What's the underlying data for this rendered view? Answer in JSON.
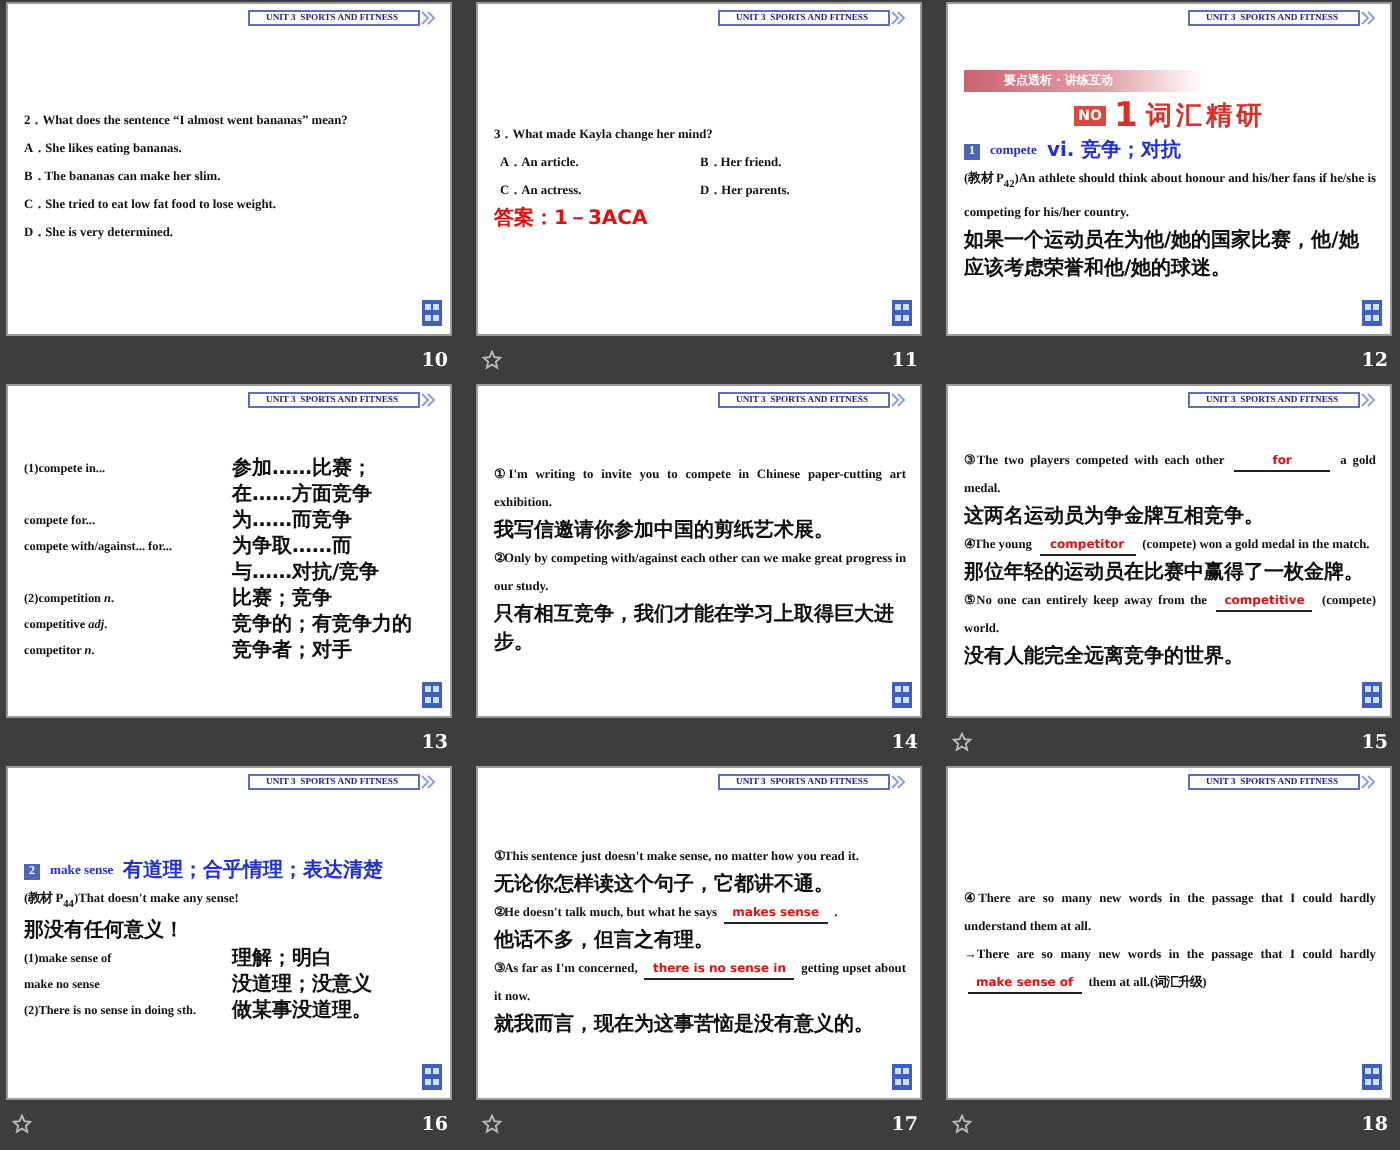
{
  "slides": [
    {
      "number": "10",
      "starred": false,
      "header": "UNIT 3  SPORTS AND FITNESS",
      "blocks": [
        {
          "kind": "en",
          "text": "2．What does the sentence “I almost went bananas” mean?"
        },
        {
          "kind": "en",
          "text": "A．She likes eating bananas."
        },
        {
          "kind": "en",
          "text": "B．The bananas can make her slim."
        },
        {
          "kind": "en",
          "text": "C．She tried to eat low fat food to lose weight."
        },
        {
          "kind": "en",
          "text": "D．She is very determined."
        }
      ]
    },
    {
      "number": "11",
      "starred": true,
      "header": "UNIT 3  SPORTS AND FITNESS",
      "blocks": [
        {
          "kind": "en",
          "text": "3．What made Kayla change her mind?"
        },
        {
          "kind": "options",
          "items": [
            "A．An article.",
            "B．Her friend.",
            "C．An actress.",
            "D．Her parents."
          ]
        },
        {
          "kind": "answer",
          "text": "答案：1－3ACA"
        }
      ]
    },
    {
      "number": "12",
      "starred": false,
      "header": "UNIT 3  SPORTS AND FITNESS",
      "blocks": [
        {
          "kind": "banner",
          "text": "要点透析 · 讲练互动",
          "badge": "NO",
          "num": "1",
          "title": "词汇精研"
        },
        {
          "kind": "heading",
          "badge": "1",
          "term": "compete",
          "meaning": "vi. 竞争；对抗"
        },
        {
          "kind": "en",
          "text": "(教材 P$_{42}$)An athlete should think about honour and his/her fans if he/she is competing for his/her country."
        },
        {
          "kind": "zh",
          "text": "如果一个运动员在为他/她的国家比赛，他/她应该考虑荣誉和他/她的球迷。"
        }
      ]
    },
    {
      "number": "13",
      "starred": false,
      "header": "UNIT 3  SPORTS AND FITNESS",
      "blocks": [
        {
          "kind": "pairs",
          "rows": [
            {
              "term": "(1)compete in...",
              "meaning": "参加……比赛；"
            },
            {
              "meaning": "在……方面竞争"
            },
            {
              "term": "compete for...",
              "meaning": "为……而竞争"
            },
            {
              "term": "compete with/against... for...",
              "meaning": "为争取……而"
            },
            {
              "meaning": "与……对抗/竞争"
            },
            {
              "term": "(2)competition *n*.",
              "meaning": "比赛；竞争"
            },
            {
              "term": "competitive *adj*.",
              "meaning": "竞争的；有竞争力的"
            },
            {
              "term": "competitor *n*.",
              "meaning": "竞争者；对手"
            }
          ]
        }
      ]
    },
    {
      "number": "14",
      "starred": false,
      "header": "UNIT 3  SPORTS AND FITNESS",
      "blocks": [
        {
          "kind": "en",
          "text": "①I'm writing to invite you to compete in Chinese paper-cutting art exhibition."
        },
        {
          "kind": "zh",
          "text": "我写信邀请你参加中国的剪纸艺术展。"
        },
        {
          "kind": "en",
          "text": "②Only by competing with/against each other can we make great progress in our study."
        },
        {
          "kind": "zh",
          "text": "只有相互竞争，我们才能在学习上取得巨大进步。"
        }
      ]
    },
    {
      "number": "15",
      "starred": true,
      "header": "UNIT 3  SPORTS AND FITNESS",
      "blocks": [
        {
          "kind": "cloze",
          "parts": [
            {
              "kind": "text",
              "text": "③The two players competed with each other"
            },
            {
              "kind": "blank",
              "text": "for"
            },
            {
              "kind": "text",
              "text": "a gold medal."
            }
          ]
        },
        {
          "kind": "zh",
          "text": "这两名运动员为争金牌互相竞争。"
        },
        {
          "kind": "cloze",
          "parts": [
            {
              "kind": "text",
              "text": "④The young"
            },
            {
              "kind": "blank",
              "text": "competitor"
            },
            {
              "kind": "text",
              "text": "(compete) won a gold medal in the match."
            }
          ]
        },
        {
          "kind": "zh",
          "text": "那位年轻的运动员在比赛中赢得了一枚金牌。"
        },
        {
          "kind": "cloze",
          "parts": [
            {
              "kind": "text",
              "text": "⑤No one can entirely keep away from the"
            },
            {
              "kind": "blank",
              "text": "competitive"
            },
            {
              "kind": "text",
              "text": "(compete) world."
            }
          ]
        },
        {
          "kind": "zh",
          "text": "没有人能完全远离竞争的世界。"
        }
      ]
    },
    {
      "number": "16",
      "starred": true,
      "header": "UNIT 3  SPORTS AND FITNESS",
      "blocks": [
        {
          "kind": "heading",
          "badge": "2",
          "term": "make sense",
          "meaning": "有道理；合乎情理；表达清楚"
        },
        {
          "kind": "en",
          "text": "(教材 P$_{44}$)That doesn't make any sense!"
        },
        {
          "kind": "zh",
          "text": "那没有任何意义！"
        },
        {
          "kind": "pairs",
          "rows": [
            {
              "term": "(1)make sense of",
              "meaning": "理解；明白"
            },
            {
              "term": "make no sense",
              "meaning": "没道理；没意义"
            },
            {
              "term": "(2)There is no sense in doing sth.",
              "meaning": "做某事没道理。"
            }
          ]
        }
      ]
    },
    {
      "number": "17",
      "starred": true,
      "header": "UNIT 3  SPORTS AND FITNESS",
      "blocks": [
        {
          "kind": "en",
          "text": "①This sentence just doesn't make sense, no matter how you read it."
        },
        {
          "kind": "zh",
          "text": "无论你怎样读这个句子，它都讲不通。"
        },
        {
          "kind": "cloze",
          "parts": [
            {
              "kind": "text",
              "text": "②He doesn't talk much, but what he says"
            },
            {
              "kind": "blank",
              "text": "makes sense"
            },
            {
              "kind": "text",
              "text": "."
            }
          ]
        },
        {
          "kind": "zh",
          "text": "他话不多，但言之有理。"
        },
        {
          "kind": "cloze",
          "parts": [
            {
              "kind": "text",
              "text": "③As far as I'm concerned,"
            },
            {
              "kind": "blank",
              "text": "there is no sense in"
            },
            {
              "kind": "text",
              "text": "getting upset about it now."
            }
          ]
        },
        {
          "kind": "zh",
          "text": "就我而言，现在为这事苦恼是没有意义的。"
        }
      ]
    },
    {
      "number": "18",
      "starred": true,
      "header": "UNIT 3  SPORTS AND FITNESS",
      "blocks": [
        {
          "kind": "en",
          "text": "④There are so many new words in the passage that I could hardly understand them at all."
        },
        {
          "kind": "cloze",
          "parts": [
            {
              "kind": "text",
              "text": "→There are so many new words in the passage that I could hardly"
            },
            {
              "kind": "blank",
              "text": "make sense of"
            },
            {
              "kind": "text",
              "text": "them at all.(词汇升级)"
            }
          ]
        }
      ]
    }
  ]
}
